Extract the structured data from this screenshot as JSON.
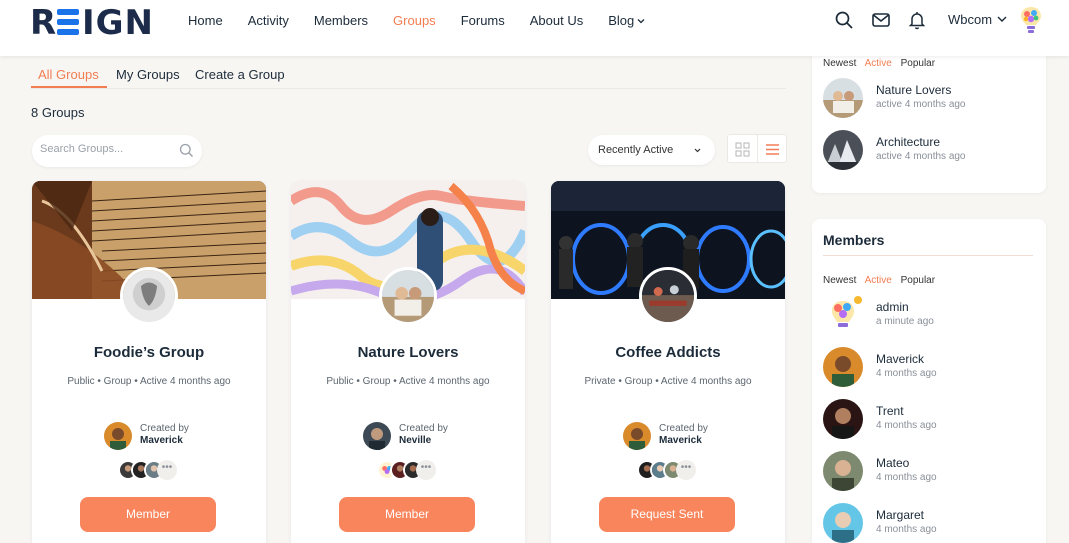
{
  "brand": {
    "logo": "REIGN",
    "accent": "#f27d53",
    "button_color": "#f8855c"
  },
  "nav": {
    "items": [
      {
        "label": "Home"
      },
      {
        "label": "Activity"
      },
      {
        "label": "Members"
      },
      {
        "label": "Groups",
        "active": true
      },
      {
        "label": "Forums"
      },
      {
        "label": "About Us"
      },
      {
        "label": "Blog"
      }
    ],
    "user_name": "Wbcom",
    "icons": [
      "search-icon",
      "mail-icon",
      "bell-icon",
      "chevron-down-icon"
    ]
  },
  "subtabs": {
    "all": "All Groups",
    "mine": "My Groups",
    "create": "Create a Group"
  },
  "groups_count": "8 Groups",
  "search": {
    "placeholder": "Search Groups..."
  },
  "sort": {
    "label": "Recently Active"
  },
  "cards": [
    {
      "name": "Foodie’s Group",
      "meta": "Public • Group • Active 4 months ago",
      "created_by_label": "Created by",
      "creator": "Maverick",
      "button": "Member"
    },
    {
      "name": "Nature Lovers",
      "meta": "Public • Group • Active 4 months ago",
      "created_by_label": "Created by",
      "creator": "Neville",
      "button": "Member"
    },
    {
      "name": "Coffee Addicts",
      "meta": "Private • Group • Active 4 months ago",
      "created_by_label": "Created by",
      "creator": "Maverick",
      "button": "Request Sent"
    }
  ],
  "more_glyph": "•••",
  "groups_widget": {
    "tabs": [
      "Newest",
      "Active",
      "Popular"
    ],
    "active_tab": "Active",
    "items": [
      {
        "name": "Nature Lovers",
        "sub": "active 4 months ago"
      },
      {
        "name": "Architecture",
        "sub": "active 4 months ago"
      }
    ]
  },
  "members_widget": {
    "title": "Members",
    "tabs": [
      "Newest",
      "Active",
      "Popular"
    ],
    "active_tab": "Active",
    "items": [
      {
        "name": "admin",
        "sub": "a minute ago"
      },
      {
        "name": "Maverick",
        "sub": "4 months ago"
      },
      {
        "name": "Trent",
        "sub": "4 months ago"
      },
      {
        "name": "Mateo",
        "sub": "4 months ago"
      },
      {
        "name": "Margaret",
        "sub": "4 months ago"
      }
    ]
  }
}
